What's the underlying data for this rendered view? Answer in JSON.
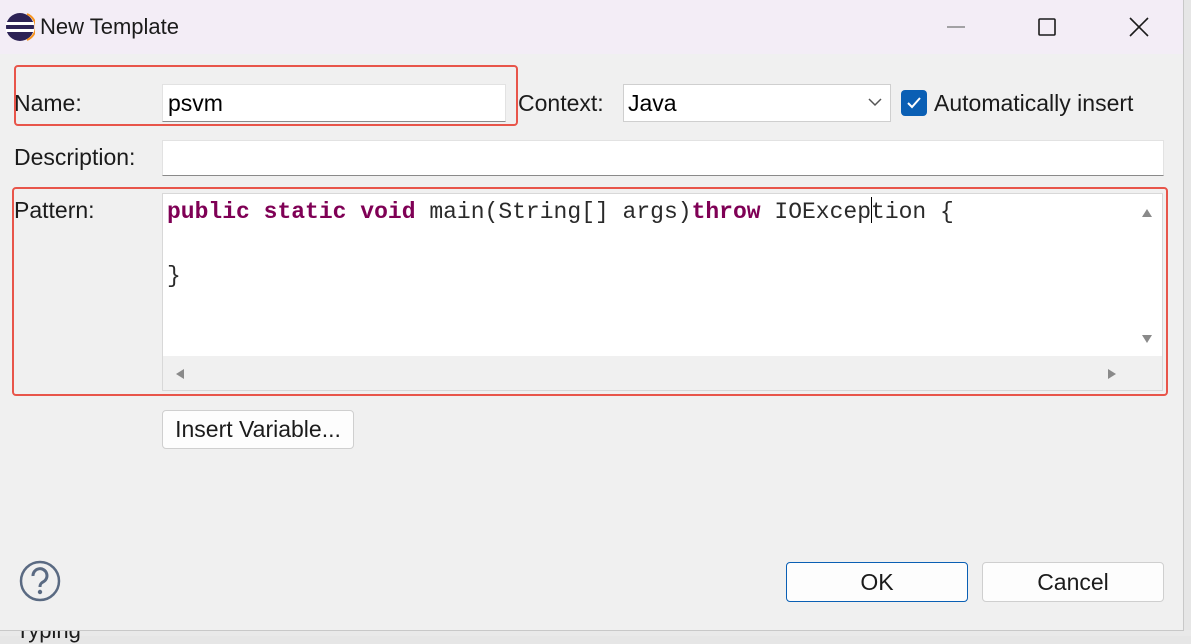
{
  "window": {
    "title": "New Template",
    "icon": "eclipse-icon",
    "controls": [
      "minimize-icon",
      "maximize-icon",
      "close-icon"
    ]
  },
  "form": {
    "name_label": "Name:",
    "name_value": "psvm",
    "context_label": "Context:",
    "context_value": "Java",
    "auto_insert_label": "Automatically insert",
    "auto_insert_checked": true,
    "description_label": "Description:",
    "description_value": "",
    "pattern_label": "Pattern:",
    "pattern_lines": {
      "line1": {
        "kw1": "public",
        "kw2": "static",
        "kw3": "void",
        "text1": "main(String[] args)",
        "kw4": "throw",
        "text2a": "IOExcep",
        "text2b": "tion {"
      },
      "line2": "",
      "line3": "}"
    },
    "insert_variable_label": "Insert Variable..."
  },
  "buttons": {
    "ok_label": "OK",
    "cancel_label": "Cancel"
  },
  "background": {
    "partial_text": "Typing"
  },
  "colors": {
    "keyword": "#7f0055",
    "highlight_border": "#e8554a",
    "accent": "#0a5fb4",
    "titlebar": "#f3edf6"
  }
}
